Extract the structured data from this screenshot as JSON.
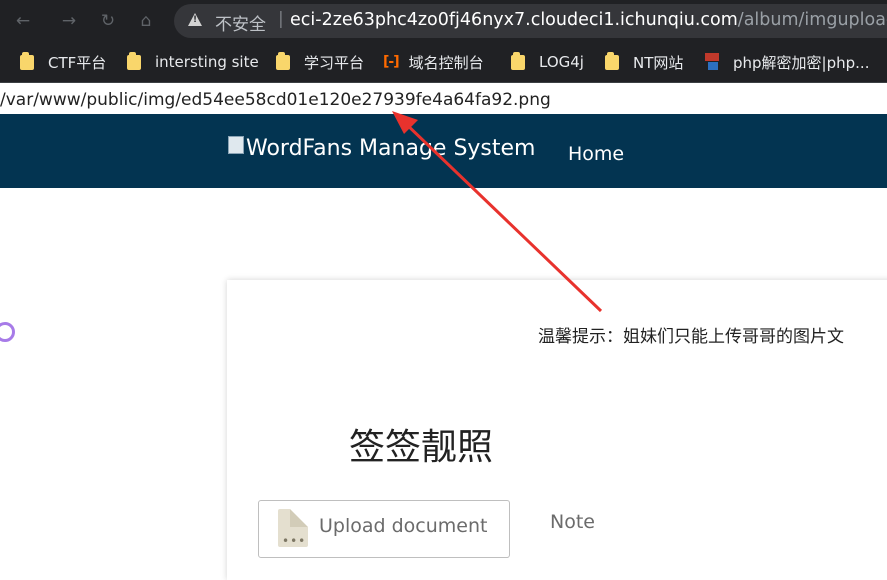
{
  "browser": {
    "not_secure_label": "不安全",
    "url_separator": "|",
    "url_host": "eci-2ze63phc4zo0fj46nyx7.cloudeci1.ichunqiu.com",
    "url_path": "/album/imgupload"
  },
  "bookmarks": [
    {
      "label": "CTF平台",
      "icon": "folder-icon"
    },
    {
      "label": "intersting site",
      "icon": "folder-icon"
    },
    {
      "label": "学习平台",
      "icon": "folder-icon"
    },
    {
      "label": "域名控制台",
      "icon": "aliyun-icon"
    },
    {
      "label": "LOG4j",
      "icon": "folder-icon"
    },
    {
      "label": "NT网站",
      "icon": "folder-icon"
    },
    {
      "label": "php解密加密|php...",
      "icon": "php-icon"
    }
  ],
  "page": {
    "path_output": "/var/www/public/img/ed54ee58cd01e120e27939fe4a64fa92.png",
    "brand_img_alt": "Word",
    "brand_title": "Fans Manage System",
    "nav_home": "Home",
    "tip": "温馨提示：姐妹们只能上传哥哥的图片文",
    "card_title": "签签靓照",
    "upload_label": "Upload document",
    "note_label": "Note"
  },
  "colors": {
    "header_bg": "#033451",
    "arrow": "#e8322d"
  }
}
